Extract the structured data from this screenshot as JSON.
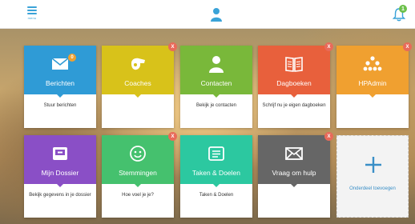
{
  "topbar": {
    "menu_label": "menu",
    "menu_icon": "hamburger-icon",
    "user_icon": "user-icon",
    "bell_icon": "bell-icon",
    "notification_count": "1",
    "accent_color": "#3aa3d8",
    "badge_color": "#6cc04a"
  },
  "tiles": [
    {
      "title": "Berichten",
      "desc": "Stuur berichten",
      "color": "#2f9bd6",
      "icon": "envelope-icon",
      "count_badge": "0",
      "closable": false
    },
    {
      "title": "Coaches",
      "desc": "",
      "color": "#d8c21a",
      "icon": "whistle-icon",
      "closable": true,
      "close_label": "X"
    },
    {
      "title": "Contacten",
      "desc": "Bekijk je contacten",
      "color": "#79b83a",
      "icon": "person-icon",
      "closable": false
    },
    {
      "title": "Dagboeken",
      "desc": "Schrijf nu je eigen dagboeken",
      "color": "#e8603c",
      "icon": "book-icon",
      "closable": true,
      "close_label": "X"
    },
    {
      "title": "HPAdmin",
      "desc": "",
      "color": "#f0a030",
      "icon": "org-chart-icon",
      "closable": true,
      "close_label": "X"
    },
    {
      "title": "Mijn Dossier",
      "desc": "Bekijk gegevens in je dossier",
      "color": "#8a4fc6",
      "icon": "dossier-icon",
      "closable": false
    },
    {
      "title": "Stemmingen",
      "desc": "Hoe voel je je?",
      "color": "#45c16e",
      "icon": "smiley-icon",
      "closable": true,
      "close_label": "X"
    },
    {
      "title": "Taken & Doelen",
      "desc": "Taken & Doelen",
      "color": "#2cc8a0",
      "icon": "tasks-icon",
      "closable": false
    },
    {
      "title": "Vraag om hulp",
      "desc": "",
      "color": "#666666",
      "icon": "envelope-icon",
      "closable": true,
      "close_label": "X"
    }
  ],
  "add_tile": {
    "label": "Onderdeel toevoegen",
    "icon": "plus-icon",
    "color": "#3a8fc7"
  }
}
